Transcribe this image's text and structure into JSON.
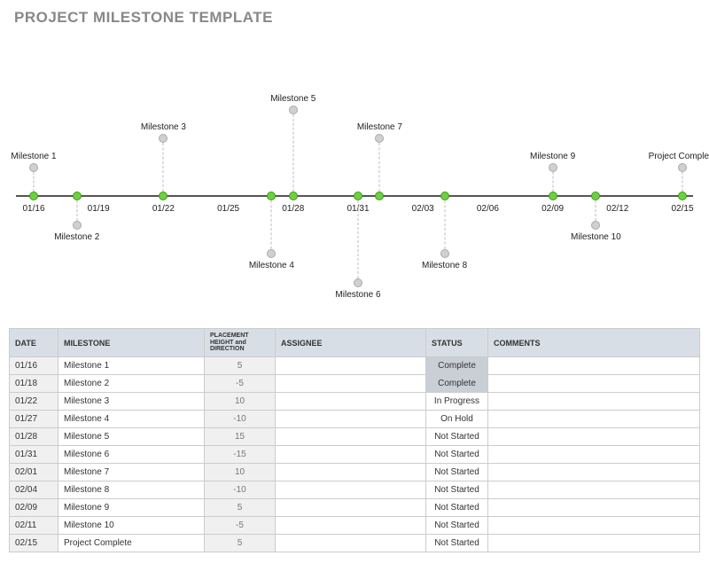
{
  "title": "PROJECT MILESTONE TEMPLATE",
  "table": {
    "headers": {
      "date": "DATE",
      "milestone": "MILESTONE",
      "placement": "PLACEMENT HEIGHT and DIRECTION",
      "assignee": "ASSIGNEE",
      "status": "STATUS",
      "comments": "COMMENTS"
    },
    "rows": [
      {
        "date": "01/16",
        "milestone": "Milestone 1",
        "placement": "5",
        "assignee": "",
        "status": "Complete",
        "comments": ""
      },
      {
        "date": "01/18",
        "milestone": "Milestone 2",
        "placement": "-5",
        "assignee": "",
        "status": "Complete",
        "comments": ""
      },
      {
        "date": "01/22",
        "milestone": "Milestone 3",
        "placement": "10",
        "assignee": "",
        "status": "In Progress",
        "comments": ""
      },
      {
        "date": "01/27",
        "milestone": "Milestone 4",
        "placement": "-10",
        "assignee": "",
        "status": "On Hold",
        "comments": ""
      },
      {
        "date": "01/28",
        "milestone": "Milestone 5",
        "placement": "15",
        "assignee": "",
        "status": "Not Started",
        "comments": ""
      },
      {
        "date": "01/31",
        "milestone": "Milestone 6",
        "placement": "-15",
        "assignee": "",
        "status": "Not Started",
        "comments": ""
      },
      {
        "date": "02/01",
        "milestone": "Milestone 7",
        "placement": "10",
        "assignee": "",
        "status": "Not Started",
        "comments": ""
      },
      {
        "date": "02/04",
        "milestone": "Milestone 8",
        "placement": "-10",
        "assignee": "",
        "status": "Not Started",
        "comments": ""
      },
      {
        "date": "02/09",
        "milestone": "Milestone 9",
        "placement": "5",
        "assignee": "",
        "status": "Not Started",
        "comments": ""
      },
      {
        "date": "02/11",
        "milestone": "Milestone 10",
        "placement": "-5",
        "assignee": "",
        "status": "Not Started",
        "comments": ""
      },
      {
        "date": "02/15",
        "milestone": "Project Complete",
        "placement": "5",
        "assignee": "",
        "status": "Not Started",
        "comments": ""
      }
    ]
  },
  "chart_data": {
    "type": "scatter",
    "title": "",
    "xlabel": "",
    "ylabel": "",
    "x_ticks": [
      "01/16",
      "01/19",
      "01/22",
      "01/25",
      "01/28",
      "01/31",
      "02/03",
      "02/06",
      "02/09",
      "02/12",
      "02/15"
    ],
    "x_range_days": [
      0,
      30
    ],
    "series": [
      {
        "name": "milestones",
        "points": [
          {
            "label": "Milestone 1",
            "x": "01/16",
            "day": 0,
            "y": 5,
            "status": "Complete"
          },
          {
            "label": "Milestone 2",
            "x": "01/18",
            "day": 2,
            "y": -5,
            "status": "Complete"
          },
          {
            "label": "Milestone 3",
            "x": "01/22",
            "day": 6,
            "y": 10,
            "status": "In Progress"
          },
          {
            "label": "Milestone 4",
            "x": "01/27",
            "day": 11,
            "y": -10,
            "status": "On Hold"
          },
          {
            "label": "Milestone 5",
            "x": "01/28",
            "day": 12,
            "y": 15,
            "status": "Not Started"
          },
          {
            "label": "Milestone 6",
            "x": "01/31",
            "day": 15,
            "y": -15,
            "status": "Not Started"
          },
          {
            "label": "Milestone 7",
            "x": "02/01",
            "day": 16,
            "y": 10,
            "status": "Not Started"
          },
          {
            "label": "Milestone 8",
            "x": "02/04",
            "day": 19,
            "y": -10,
            "status": "Not Started"
          },
          {
            "label": "Milestone 9",
            "x": "02/09",
            "day": 24,
            "y": 5,
            "status": "Not Started"
          },
          {
            "label": "Milestone 10",
            "x": "02/11",
            "day": 26,
            "y": -5,
            "status": "Not Started"
          },
          {
            "label": "Project Complete",
            "x": "02/15",
            "day": 30,
            "y": 5,
            "status": "Not Started"
          }
        ]
      }
    ]
  }
}
